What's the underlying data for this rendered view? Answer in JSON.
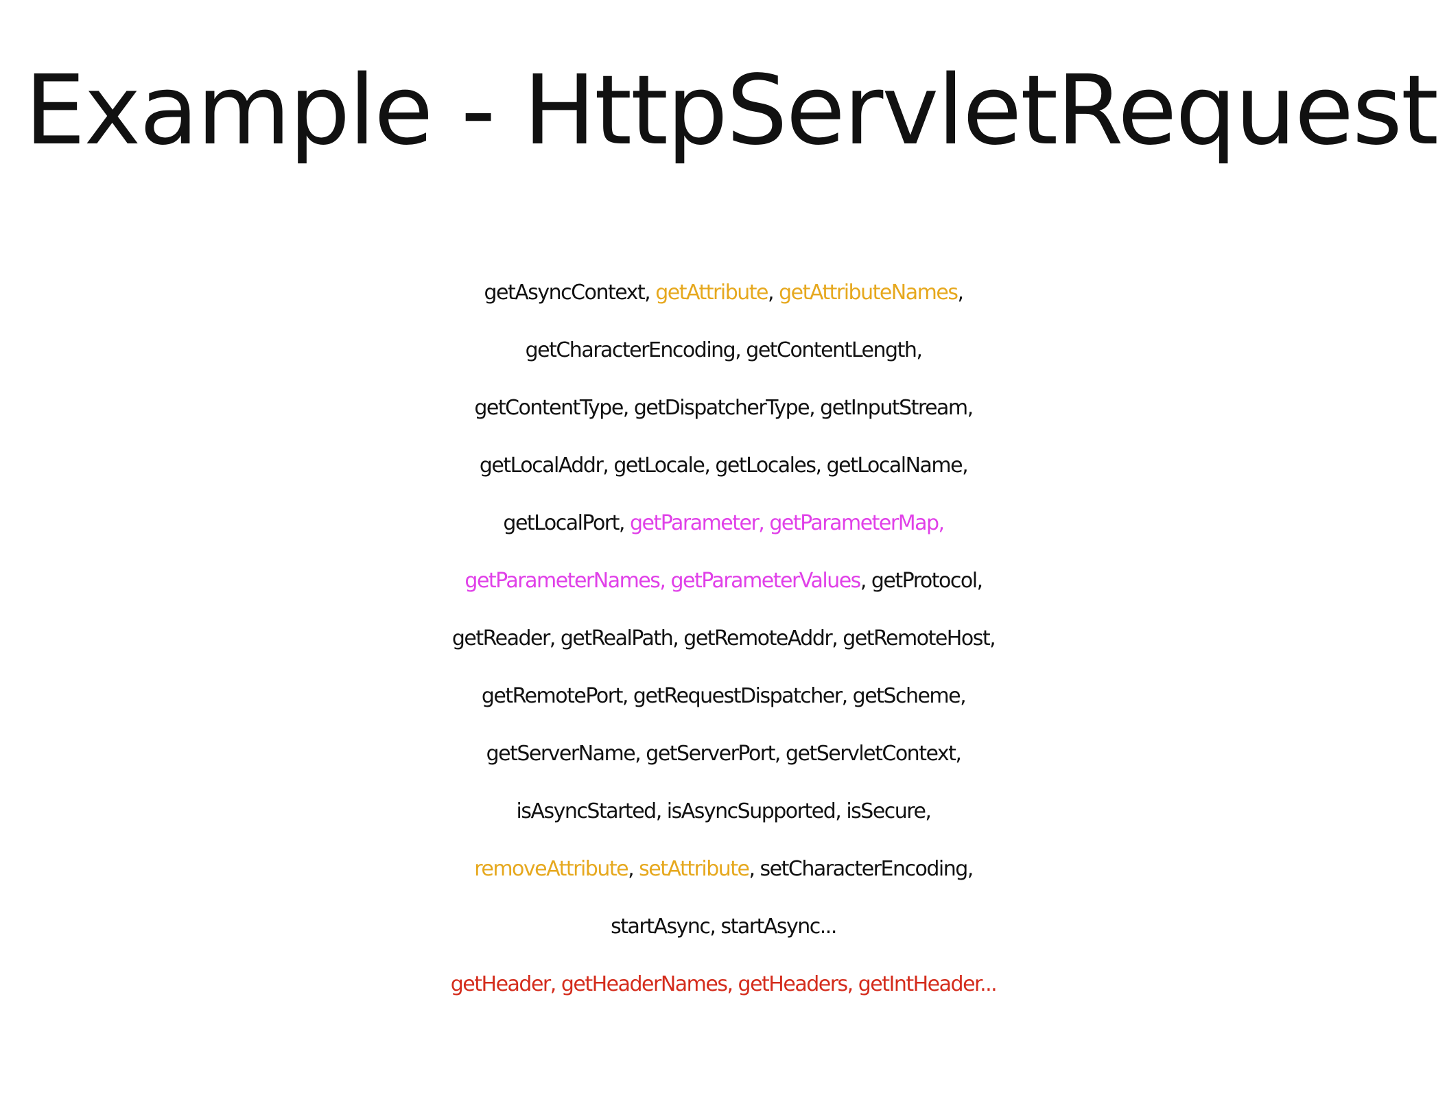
{
  "slide": {
    "title": "Example - HttpServletRequest",
    "colors": {
      "default": "#111111",
      "attribute": "#e6a81e",
      "parameter": "#e040e8",
      "header": "#d42c1c"
    },
    "lines": [
      [
        {
          "text": "getAsyncContext, ",
          "group": "default"
        },
        {
          "text": "getAttribute",
          "group": "attribute"
        },
        {
          "text": ", ",
          "group": "default"
        },
        {
          "text": "getAttributeNames",
          "group": "attribute"
        },
        {
          "text": ",",
          "group": "default"
        }
      ],
      [
        {
          "text": "getCharacterEncoding, getContentLength,",
          "group": "default"
        }
      ],
      [
        {
          "text": "getContentType, getDispatcherType, getInputStream,",
          "group": "default"
        }
      ],
      [
        {
          "text": "getLocalAddr, getLocale, getLocales, getLocalName,",
          "group": "default"
        }
      ],
      [
        {
          "text": "getLocalPort, ",
          "group": "default"
        },
        {
          "text": "getParameter, getParameterMap,",
          "group": "parameter"
        }
      ],
      [
        {
          "text": "getParameterNames, getParameterValues",
          "group": "parameter"
        },
        {
          "text": ", getProtocol,",
          "group": "default"
        }
      ],
      [
        {
          "text": "getReader, getRealPath, getRemoteAddr, getRemoteHost,",
          "group": "default"
        }
      ],
      [
        {
          "text": "getRemotePort, getRequestDispatcher, getScheme,",
          "group": "default"
        }
      ],
      [
        {
          "text": "getServerName, getServerPort, getServletContext,",
          "group": "default"
        }
      ],
      [
        {
          "text": "isAsyncStarted, isAsyncSupported, isSecure,",
          "group": "default"
        }
      ],
      [
        {
          "text": "removeAttribute",
          "group": "attribute"
        },
        {
          "text": ", ",
          "group": "default"
        },
        {
          "text": "setAttribute",
          "group": "attribute"
        },
        {
          "text": ", setCharacterEncoding,",
          "group": "default"
        }
      ],
      [
        {
          "text": "startAsync, startAsync...",
          "group": "default"
        }
      ],
      [
        {
          "text": "getHeader, getHeaderNames, getHeaders, getIntHeader...",
          "group": "header"
        }
      ]
    ]
  }
}
